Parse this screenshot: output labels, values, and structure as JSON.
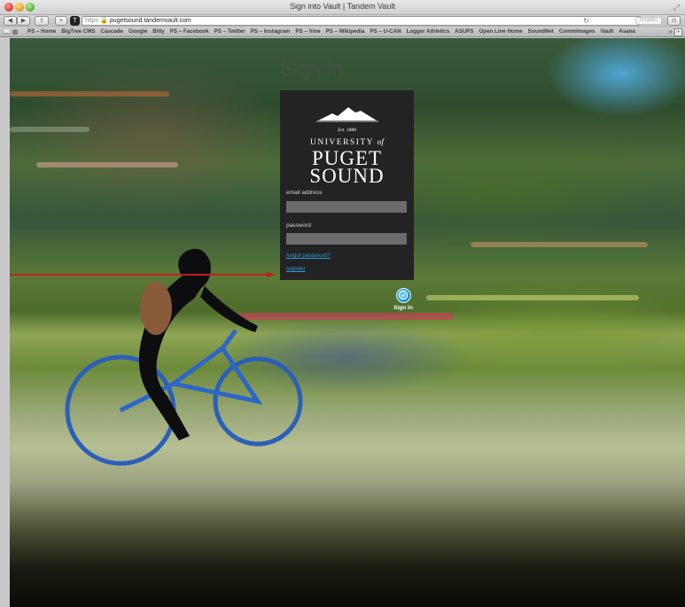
{
  "window": {
    "title": "Sign into Vault | Tandem Vault"
  },
  "toolbar": {
    "url_protocol": "https",
    "url_host": "pugetsound.tandemvault.com",
    "reader_label": "Reader",
    "tab_icon_letter": "T"
  },
  "bookmarks": [
    "PS – Home",
    "BigTree CMS",
    "Cascade",
    "Google",
    "Bitly",
    "PS – Facebook",
    "PS – Twitter",
    "PS – Instagram",
    "PS – Vine",
    "PS – Wikipedia",
    "PS – U-CAN",
    "Logger Athletics",
    "ASUPS",
    "Open Line Home",
    "SoundNet",
    "CommImages",
    "Vault",
    "Asana"
  ],
  "page": {
    "heading": "Sign In",
    "logo": {
      "est": "Est. 1888",
      "university": "UNIVERSITY",
      "of": "of",
      "puget": "PUGET",
      "sound": "SOUND"
    },
    "email": {
      "label": "email address",
      "value": "",
      "placeholder": ""
    },
    "password": {
      "label": "password",
      "value": "",
      "placeholder": ""
    },
    "forgot_link": "forgot password?",
    "register_link": "register",
    "sign_in_button": "Sign In"
  },
  "colors": {
    "panel_bg": "#232323",
    "input_bg": "#6b6b6b",
    "link": "#2d9cdb",
    "button": "#1c8fd0",
    "arrow": "#c0201e"
  },
  "icons": [
    "traffic-light-close-icon",
    "back-icon",
    "forward-icon",
    "share-icon",
    "new-tab-icon",
    "lock-icon",
    "reload-icon",
    "bookmarks-icon",
    "top-sites-icon",
    "fullscreen-icon",
    "checkmark-icon"
  ]
}
